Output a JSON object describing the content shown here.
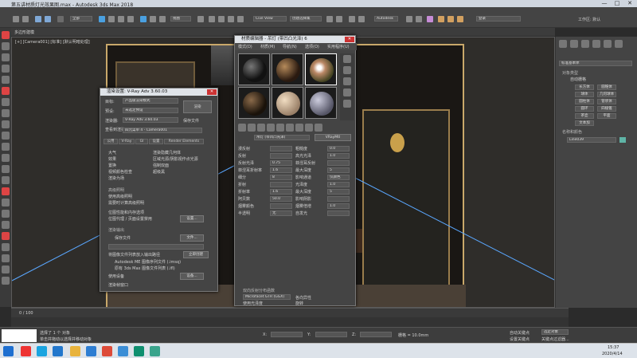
{
  "window": {
    "title": "第五讲材质灯光效果图.max - Autodesk 3ds Max 2018",
    "minimize": "—",
    "maximize": "□",
    "close": "✕"
  },
  "toolbar": {
    "undo_icon": "undo-icon",
    "view_dropdown": "Civil View",
    "selection_set": "创建选择集",
    "workspace": "Autodesk",
    "search_placeholder": "登录",
    "workspaces_label": "工作区: 默认"
  },
  "viewport": {
    "label": "[+] [Camera001] [标准] [默认明暗处理]"
  },
  "render_dialog": {
    "title": "渲染设置: V-Ray Adv 3.60.03",
    "target_label": "目标:",
    "target_value": "产品级渲染模式",
    "preset_label": "预设:",
    "preset_value": "未选定预设",
    "renderer_label": "渲染器:",
    "renderer_value": "V-Ray Adv 3.60.03",
    "save_file_label": "保存文件",
    "render_button": "渲染",
    "view_label": "查看到渲染:",
    "view_value": "四元菜单 4 - Camera001",
    "tabs": [
      "公用",
      "V-Ray",
      "GI",
      "设置",
      "Render Elements"
    ],
    "options": [
      "大气",
      "效果",
      "置换",
      "视频颜色检查",
      "渲染为场",
      "渲染隐藏几何体",
      "区域光源/阴影视作点光源",
      "强制双面",
      "超级黑"
    ],
    "advanced_lighting_header": "高级照明",
    "use_advanced_lighting": "使用高级照明",
    "compute_advanced": "需要时计算高级照明",
    "bitmap_perf": "位图性能和内存选项",
    "bitmap_proxy": "位图代理 / 页面设置禁用",
    "setup_button": "设置...",
    "render_output_header": "渲染输出",
    "save_file": "保存文件",
    "files_button": "文件...",
    "put_image_label": "将图像文件列表放入输出路径",
    "create_now_button": "立即创建",
    "autodesk_me": "Autodesk ME 图像序列文件 (.imsq)",
    "legacy_3ds": "原有 3ds Max 图像文件列表 (.ifl)",
    "use_device": "使用设备",
    "devices_button": "设备...",
    "render_frame_window": "渲染帧窗口"
  },
  "material_editor": {
    "title": "材质编辑器 - 吊灯 (带凹凸光泽) 6",
    "menu": [
      "模式(D)",
      "材质(M)",
      "导航(N)",
      "选项(O)",
      "实用程序(U)"
    ],
    "material_name": "吊灯 (带凹凸光泽)",
    "material_type": "VRayMtl",
    "params": [
      {
        "label": "漫反射",
        "value": ""
      },
      {
        "label": "粗糙度",
        "value": "0.0"
      },
      {
        "label": "反射",
        "value": ""
      },
      {
        "label": "高光光泽",
        "value": "1.0"
      },
      {
        "label": "反射光泽",
        "value": "0.75"
      },
      {
        "label": "菲涅耳反射",
        "value": ""
      },
      {
        "label": "菲涅耳折射率",
        "value": "1.6"
      },
      {
        "label": "最大深度",
        "value": "5"
      },
      {
        "label": "细分",
        "value": "8"
      },
      {
        "label": "影响通道",
        "value": "仅颜色"
      },
      {
        "label": "折射",
        "value": ""
      },
      {
        "label": "光泽度",
        "value": "1.0"
      },
      {
        "label": "折射率",
        "value": "1.6"
      },
      {
        "label": "最大深度",
        "value": "5"
      },
      {
        "label": "阿贝数",
        "value": "50.0"
      },
      {
        "label": "影响阴影",
        "value": ""
      },
      {
        "label": "烟雾颜色",
        "value": ""
      },
      {
        "label": "烟雾倍增",
        "value": "1.0"
      },
      {
        "label": "半透明",
        "value": "无"
      },
      {
        "label": "自发光",
        "value": ""
      }
    ],
    "brdf_header": "双向反射分布函数",
    "brdf_type": "Microfacet GTR (GGX)",
    "use_glossiness": "使用光泽度",
    "anisotropy": "各向异性",
    "rotation": "旋转"
  },
  "command_panel": {
    "object_type_header": "对象类型",
    "autogrid": "自动栅格",
    "standard_primitives": "标准基本体",
    "buttons": [
      "长方体",
      "圆锥体",
      "球体",
      "几何球体",
      "圆柱体",
      "管状体",
      "圆环",
      "四棱锥",
      "茶壶",
      "平面",
      "文本加",
      ""
    ],
    "name_color_header": "名称和颜色",
    "object_name": "Line039",
    "accent": "#5fb4a6"
  },
  "timeline": {
    "frame": "0 / 100"
  },
  "status": {
    "line1": "选择了 1 个 对象",
    "line2": "单击并拖动以选择并移动对象",
    "coords_x": "X:",
    "coords_y": "Y:",
    "coords_z": "Z:",
    "grid": "栅格 = 10.0mm",
    "auto_key": "自动关键点",
    "selected": "选定对象",
    "set_key": "设置关键点",
    "key_filters": "关键点过滤器...",
    "maxscript": "迷你侦听器"
  },
  "taskbar": {
    "time": "15:37",
    "date": "2020/4/14"
  }
}
